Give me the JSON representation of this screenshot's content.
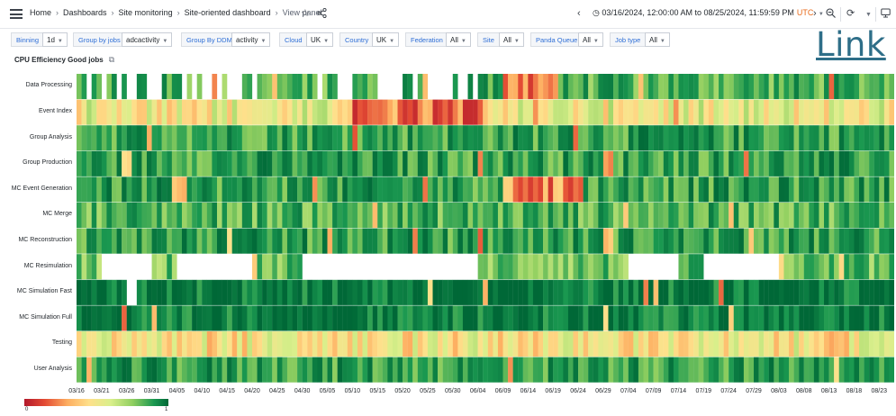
{
  "topbar": {
    "menu_icon": "hamburger-menu-icon",
    "breadcrumbs": [
      "Home",
      "Dashboards",
      "Site monitoring",
      "Site-oriented dashboard",
      "View panel"
    ],
    "star_icon": "star-icon",
    "share_icon": "share-icon",
    "time_range": "03/16/2024, 12:00:00 AM to 08/25/2024, 11:59:59 PM",
    "timezone": "UTC",
    "clock_icon": "clock-icon",
    "zoom_icon": "zoom-out-icon",
    "refresh_icon": "refresh-icon",
    "tv_icon": "tv-mode-icon",
    "accent": "#e86a1a"
  },
  "variables": [
    {
      "label": "Binning",
      "value": "1d"
    },
    {
      "label": "Group by jobs",
      "value": "adcactivity"
    },
    {
      "label": "Group By DDM",
      "value": "activity"
    },
    {
      "label": "Cloud",
      "value": "UK"
    },
    {
      "label": "Country",
      "value": "UK"
    },
    {
      "label": "Federation",
      "value": "All"
    },
    {
      "label": "Site",
      "value": "All"
    },
    {
      "label": "Panda Queue",
      "value": "All"
    },
    {
      "label": "Job type",
      "value": "All"
    }
  ],
  "overlay_text": "Link",
  "panel": {
    "title": "CPU Efficiency Good jobs",
    "link_icon": "external-link-icon"
  },
  "chart_data": {
    "type": "heatmap",
    "title": "CPU Efficiency Good jobs",
    "rows": [
      "Data Processing",
      "Event Index",
      "Group Analysis",
      "Group Production",
      "MC Event Generation",
      "MC Merge",
      "MC Reconstruction",
      "MC Resimulation",
      "MC Simulation Fast",
      "MC Simulation Full",
      "Testing",
      "User Analysis"
    ],
    "x_ticks": [
      "03/16",
      "03/21",
      "03/26",
      "03/31",
      "04/05",
      "04/10",
      "04/15",
      "04/20",
      "04/25",
      "04/30",
      "05/05",
      "05/10",
      "05/15",
      "05/20",
      "05/25",
      "05/30",
      "06/04",
      "06/09",
      "06/14",
      "06/19",
      "06/24",
      "06/29",
      "07/04",
      "07/09",
      "07/14",
      "07/19",
      "07/24",
      "07/29",
      "08/03",
      "08/08",
      "08/13",
      "08/18",
      "08/23"
    ],
    "x_start": "03/16/2024",
    "x_end": "08/25/2024",
    "binning": "1d",
    "color_scale": {
      "min": 0,
      "max": 1,
      "colors": [
        "#b2182b",
        "#e34a33",
        "#fdae61",
        "#fee08b",
        "#d9ef8b",
        "#91cf60",
        "#1a9850",
        "#006837"
      ]
    },
    "legend": {
      "min_label": "0",
      "max_label": "1",
      "position": "bottom-left"
    },
    "row_profiles": [
      {
        "row": "Data Processing",
        "typical": 0.8,
        "gaps": "sparse in 03/16-06/04",
        "low_periods": [
          "06/09-06/19"
        ]
      },
      {
        "row": "Event Index",
        "typical": 0.5,
        "gaps": "none",
        "low_periods": [
          "05/10-06/04"
        ]
      },
      {
        "row": "Group Analysis",
        "typical": 0.85,
        "gaps": "none",
        "low_periods": []
      },
      {
        "row": "Group Production",
        "typical": 0.85,
        "gaps": "none",
        "low_periods": [
          "06/29"
        ]
      },
      {
        "row": "MC Event Generation",
        "typical": 0.85,
        "gaps": "none",
        "low_periods": [
          "04/05",
          "06/09-06/24"
        ]
      },
      {
        "row": "MC Merge",
        "typical": 0.8,
        "gaps": "none",
        "low_periods": []
      },
      {
        "row": "MC Reconstruction",
        "typical": 0.85,
        "gaps": "none",
        "low_periods": [
          "06/29"
        ]
      },
      {
        "row": "MC Resimulation",
        "typical": 0.75,
        "gaps": "03/21-03/31, 04/05-04/20, 04/30-06/04, 07/04-07/14, 07/19-08/03",
        "low_periods": []
      },
      {
        "row": "MC Simulation Fast",
        "typical": 0.95,
        "gaps": "03/26",
        "low_periods": []
      },
      {
        "row": "MC Simulation Full",
        "typical": 0.95,
        "gaps": "none",
        "low_periods": []
      },
      {
        "row": "Testing",
        "typical": 0.45,
        "gaps": "none",
        "low_periods": []
      },
      {
        "row": "User Analysis",
        "typical": 0.85,
        "gaps": "none",
        "low_periods": []
      }
    ]
  }
}
